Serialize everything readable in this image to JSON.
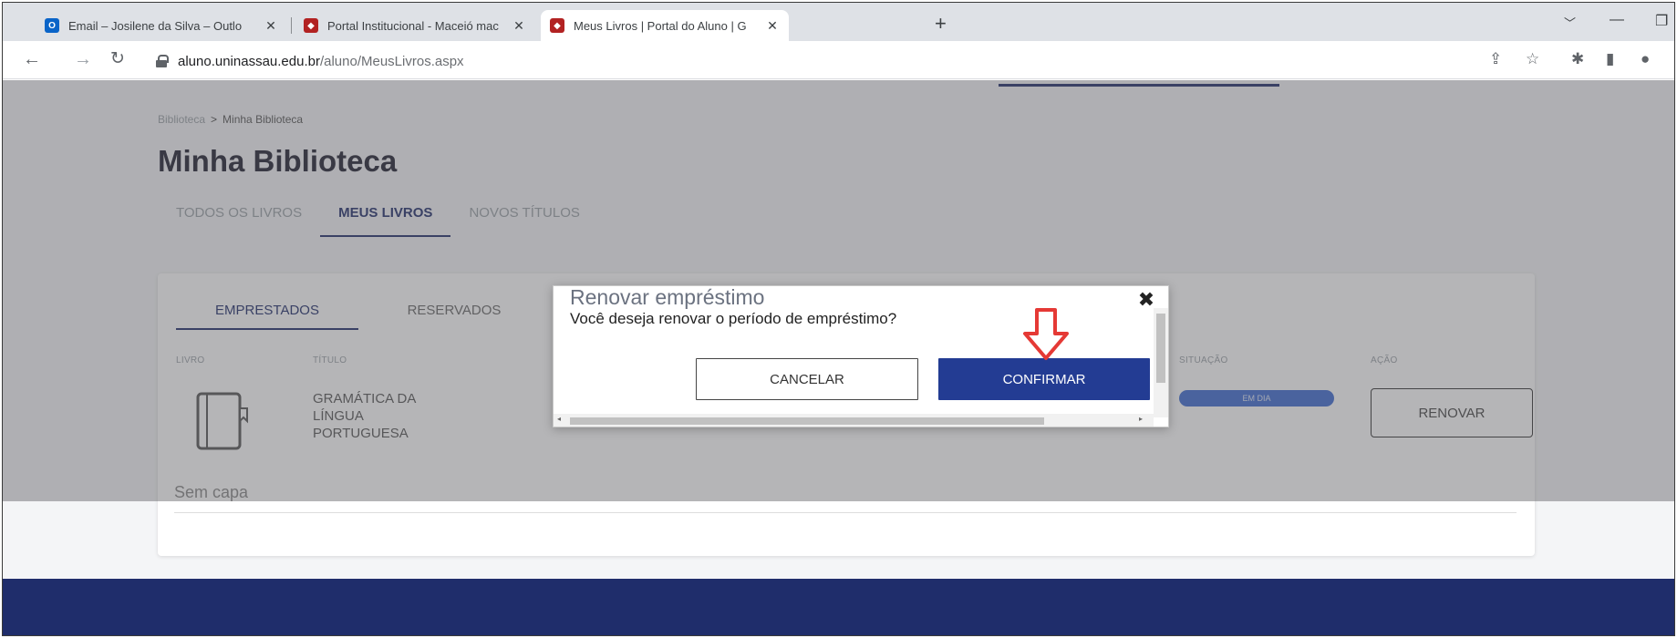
{
  "browser": {
    "tabs": [
      {
        "title": "Email – Josilene da Silva – Outlo",
        "favicon_color": "#0a64c8",
        "favicon_icon": "outlook-icon",
        "active": false
      },
      {
        "title": "Portal Institucional - Maceió mac",
        "favicon_color": "#b22222",
        "favicon_icon": "shield-icon",
        "active": false
      },
      {
        "title": "Meus Livros | Portal do Aluno | G",
        "favicon_color": "#b22222",
        "favicon_icon": "shield-icon",
        "active": true
      }
    ],
    "address": {
      "host": "aluno.uninassau.edu.br",
      "path": "/aluno/MeusLivros.aspx"
    }
  },
  "page": {
    "breadcrumb": {
      "parent": "Biblioteca",
      "current": "Minha Biblioteca"
    },
    "title": "Minha Biblioteca",
    "nav_tabs": [
      {
        "label": "TODOS OS LIVROS",
        "active": false
      },
      {
        "label": "MEUS LIVROS",
        "active": true
      },
      {
        "label": "NOVOS TÍTULOS",
        "active": false
      }
    ],
    "sub_tabs": [
      {
        "label": "EMPRESTADOS",
        "active": true
      },
      {
        "label": "RESERVADOS",
        "active": false
      }
    ],
    "columns": {
      "livro": "LIVRO",
      "titulo": "TÍTULO",
      "situacao": "SITUAÇÃO",
      "acao": "AÇÃO"
    },
    "book": {
      "title": "GRAMÁTICA DA LÍNGUA PORTUGUESA",
      "status": "EM DIA",
      "action_label": "RENOVAR",
      "cover_text": "Sem capa"
    },
    "colors": {
      "brand": "#1f2d6b",
      "confirm": "#233c93",
      "annotation_arrow": "#e53935"
    }
  },
  "modal": {
    "title": "Renovar empréstimo",
    "message": "Você deseja renovar o período de empréstimo?",
    "cancel_label": "CANCELAR",
    "confirm_label": "CONFIRMAR"
  }
}
